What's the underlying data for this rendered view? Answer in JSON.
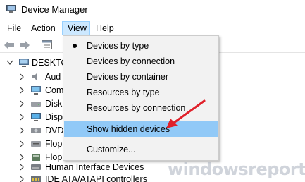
{
  "window": {
    "title": "Device Manager"
  },
  "menubar": {
    "file": "File",
    "action": "Action",
    "view": "View",
    "help": "Help"
  },
  "toolbar": {
    "back_icon": "back-arrow-icon",
    "forward_icon": "forward-arrow-icon",
    "properties_icon": "properties-icon"
  },
  "tree": {
    "root": "DESKTOP",
    "items": [
      {
        "label": "Aud",
        "icon": "audio-icon"
      },
      {
        "label": "Com",
        "icon": "computer-icon"
      },
      {
        "label": "Disk",
        "icon": "disk-drive-icon"
      },
      {
        "label": "Disp",
        "icon": "display-adapter-icon"
      },
      {
        "label": "DVD",
        "icon": "dvd-drive-icon"
      },
      {
        "label": "Flop",
        "icon": "floppy-drive-icon"
      },
      {
        "label": "Flop",
        "icon": "floppy-controller-icon"
      },
      {
        "label": "Human Interface Devices",
        "icon": "hid-icon"
      },
      {
        "label": "IDE ATA/ATAPI controllers",
        "icon": "ide-controller-icon"
      }
    ]
  },
  "view_menu": {
    "items": [
      {
        "label": "Devices by type",
        "checked": true
      },
      {
        "label": "Devices by connection"
      },
      {
        "label": "Devices by container"
      },
      {
        "label": "Resources by type"
      },
      {
        "label": "Resources by connection"
      },
      {
        "label": "Show hidden devices",
        "highlighted": true
      },
      {
        "label": "Customize..."
      }
    ]
  },
  "annotation": {
    "arrow_color": "#e0202a"
  },
  "watermark": {
    "text": "windowsreport"
  },
  "colors": {
    "menu_highlight": "#91c9f7",
    "menu_open": "#cce8ff",
    "menu_bg": "#f2f2f2"
  }
}
